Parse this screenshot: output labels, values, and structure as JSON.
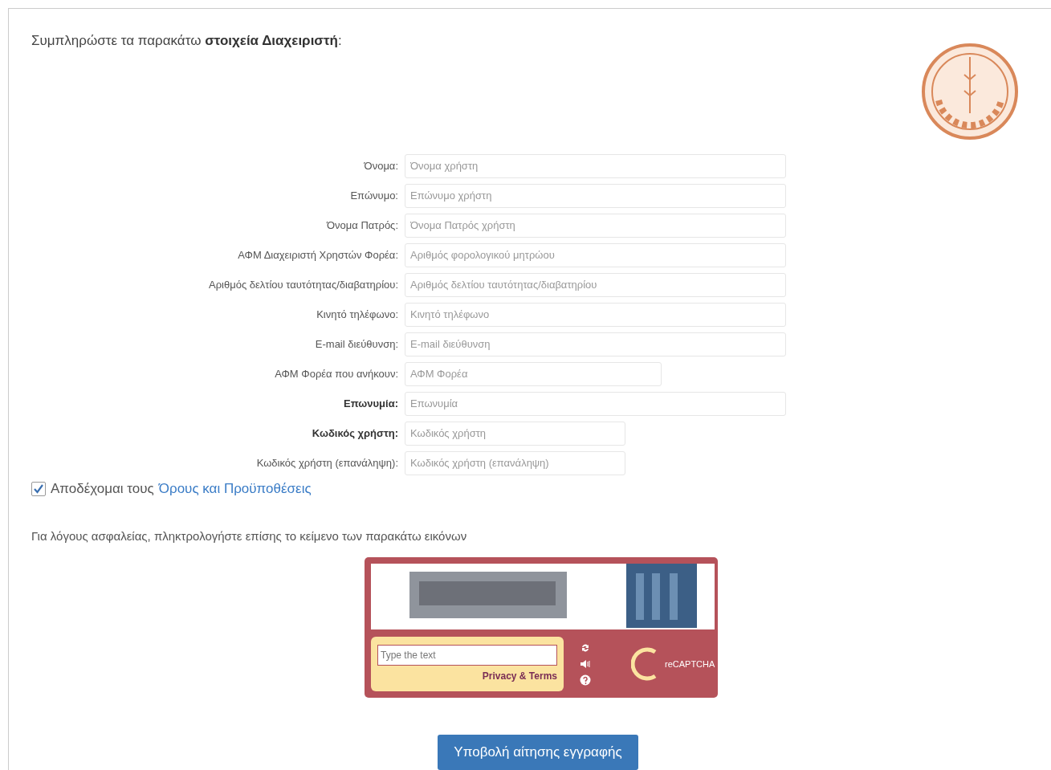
{
  "heading": "Συμπληρώστε τα παρακάτω **στοιχεία Διαχειριστή**:",
  "fields": [
    {
      "label": "Όνομα:",
      "placeholder": "Όνομα χρήστη",
      "required": false
    },
    {
      "label": "Επώνυμο:",
      "placeholder": "Επώνυμο χρήστη",
      "required": false
    },
    {
      "label": "Όνομα Πατρός:",
      "placeholder": "Όνομα Πατρός χρήστη",
      "required": false
    },
    {
      "label": "ΑΦΜ Διαχειριστή Χρηστών Φορέα:",
      "placeholder": "Αριθμός φορολογικού μητρώου",
      "required": false
    },
    {
      "label": "Αριθμός δελτίου ταυτότητας/διαβατηρίου:",
      "placeholder": "Αριθμός δελτίου ταυτότητας/διαβατηρίου",
      "required": false
    },
    {
      "label": "Κινητό τηλέφωνο:",
      "placeholder": "Κινητό τηλέφωνο",
      "required": false
    },
    {
      "label": "E-mail διεύθυνση:",
      "placeholder": "E-mail διεύθυνση",
      "required": false
    },
    {
      "label": "ΑΦΜ Φορέα που ανήκουν:",
      "placeholder": "ΑΦΜ Φορέα",
      "required": false
    },
    {
      "label": "Επωνυμία:",
      "placeholder": "Επωνυμία",
      "required": true
    },
    {
      "label": "Κωδικός χρήστη:",
      "placeholder": "Κωδικός χρήστη",
      "required": true
    },
    {
      "label": "Κωδικός χρήστη (επανάληψη):",
      "placeholder": "Κωδικός χρήστη (επανάληψη)",
      "required": false
    }
  ],
  "terms": {
    "label": "Αποδέχομαι τους",
    "link": "Όρους και Προϋποθέσεις",
    "checked": true
  },
  "captcha_note": "Για λόγους ασφαλείας, πληκτρολογήστε επίσης το κείμενο των παρακάτω εικόνων",
  "captcha": {
    "placeholder": "Type the text",
    "privacy_link": "Privacy & Terms",
    "brand": "reCAPTCHA"
  },
  "submit": "Υποβολή αίτησης εγγραφής"
}
